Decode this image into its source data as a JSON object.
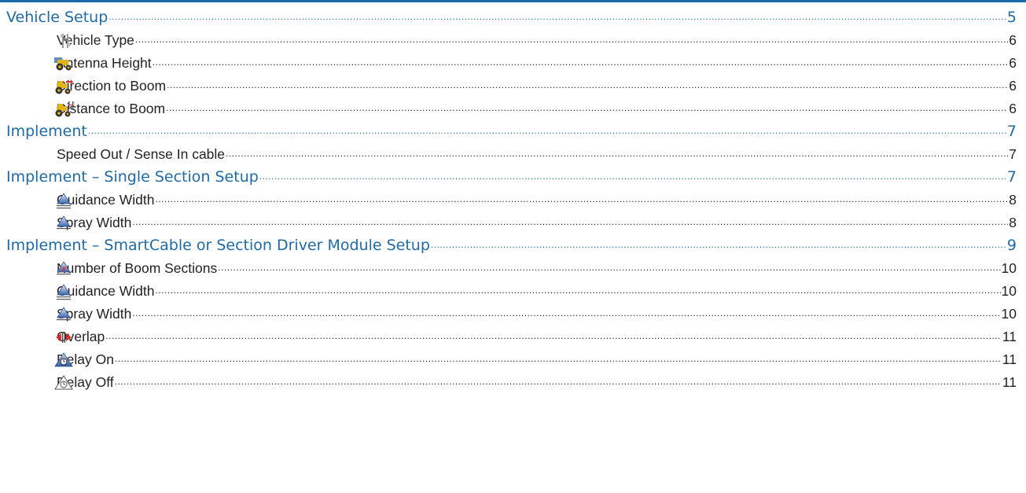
{
  "toc": {
    "entries": [
      {
        "type": "section",
        "title": "Vehicle Setup",
        "page": "5"
      },
      {
        "type": "sub",
        "icon": "vehicle-type-icon",
        "title": "Vehicle Type",
        "page": "6"
      },
      {
        "type": "sub",
        "icon": "antenna-height-icon",
        "title": "Antenna Height",
        "page": "6"
      },
      {
        "type": "sub",
        "icon": "direction-to-boom-icon",
        "title": "Direction to Boom",
        "page": "6"
      },
      {
        "type": "sub",
        "icon": "distance-to-boom-icon",
        "title": "Distance to Boom",
        "page": "6"
      },
      {
        "type": "section",
        "title": "Implement",
        "page": "7"
      },
      {
        "type": "sub",
        "icon": "",
        "title": "Speed Out / Sense In cable",
        "page": "7"
      },
      {
        "type": "section",
        "title": "Implement – Single Section Setup",
        "page": "7"
      },
      {
        "type": "sub",
        "icon": "guidance-width-icon",
        "title": "Guidance Width",
        "page": "8"
      },
      {
        "type": "sub",
        "icon": "spray-width-icon",
        "title": "Spray Width",
        "page": "8"
      },
      {
        "type": "section",
        "title": "Implement – SmartCable or Section Driver Module Setup",
        "page": "9"
      },
      {
        "type": "sub",
        "icon": "number-of-boom-sections-icon",
        "title": "Number of Boom Sections",
        "page": "10"
      },
      {
        "type": "sub",
        "icon": "guidance-width-icon",
        "title": "Guidance Width",
        "page": "10"
      },
      {
        "type": "sub",
        "icon": "spray-width-icon",
        "title": "Spray Width",
        "page": "10"
      },
      {
        "type": "sub",
        "icon": "overlap-icon",
        "title": "Overlap",
        "page": "11"
      },
      {
        "type": "sub",
        "icon": "delay-on-icon",
        "title": "Delay On",
        "page": "11"
      },
      {
        "type": "sub",
        "icon": "delay-off-icon",
        "title": "Delay Off",
        "page": "11"
      }
    ]
  },
  "colors": {
    "section_text": "#1f6aa5",
    "body_text": "#231f20",
    "rule": "#1a6aa8"
  }
}
